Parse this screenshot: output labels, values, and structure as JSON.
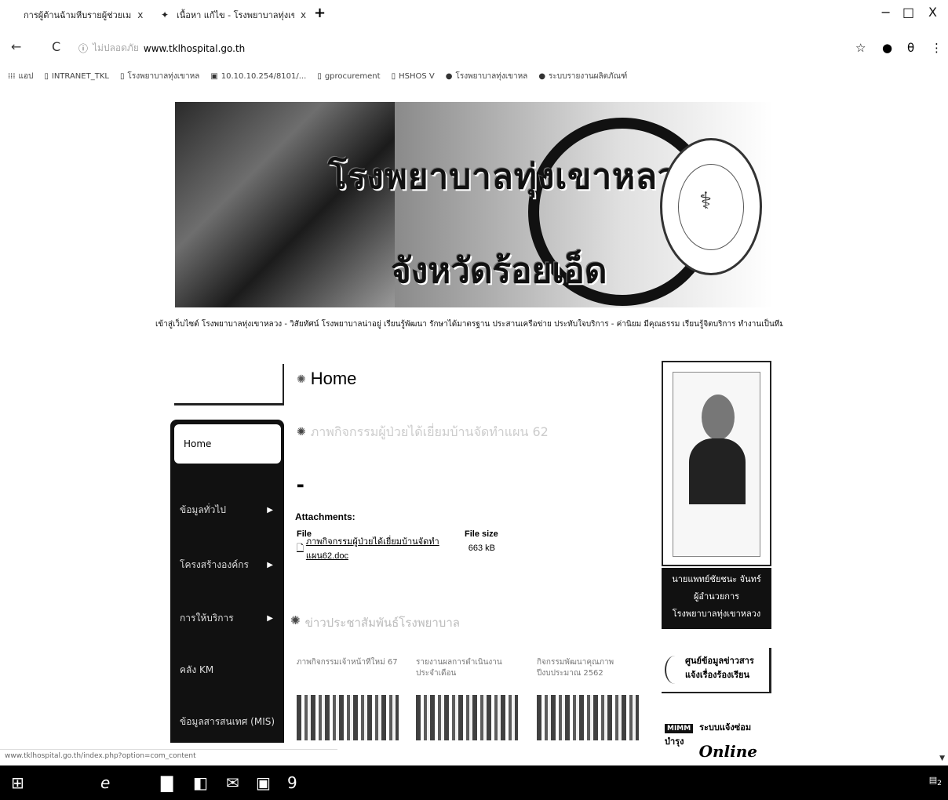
{
  "browser": {
    "tabs": [
      {
        "title": "การผู้ต้านฉ้ามหีบรายผู้ช่วยเม",
        "close": "x"
      },
      {
        "title": "เนื้อหา แก้ไข - โรงพยาบาลทุ่งเขา",
        "close": "x"
      }
    ],
    "new_tab": "+",
    "window_controls": {
      "minimize": "−",
      "maximize": "□",
      "close": "X"
    },
    "nav": {
      "back": "←",
      "reload": "C"
    },
    "url": {
      "scheme": "ไม่ปลอดภัย",
      "host": "www.tklhospital.go.th"
    },
    "bookmarks": [
      {
        "label": "แอป"
      },
      {
        "label": "INTRANET_TKL"
      },
      {
        "label": "โรงพยาบาลทุ่งเขาหล"
      },
      {
        "label": "10.10.10.254/8101/..."
      },
      {
        "label": "gprocurement"
      },
      {
        "label": "HSHOS V"
      },
      {
        "label": "โรงพยาบาลทุ่งเขาหล"
      },
      {
        "label": "ระบบรายงานผลิตภัณฑ์"
      }
    ]
  },
  "banner": {
    "title": "โรงพยาบาลทุ่งเขาหลวง",
    "subtitle": "จังหวัดร้อยเอ็ด"
  },
  "marquee": "เข้าสู่เว็บไซต์ โรงพยาบาลทุ่งเขาหลวง - วิสัยทัศน์ โรงพยาบาลน่าอยู่ เรียนรู้พัฒนา รักษาได้มาตรฐาน ประสานเครือข่าย ประทับใจบริการ - ค่านิยม มีคุณธรรม เรียนรู้จิตบริการ ทำงานเป็นทีม",
  "sidebar": {
    "items": [
      {
        "label": "Home",
        "arrow": ""
      },
      {
        "label": "ข้อมูลทั่วไป",
        "arrow": "▶"
      },
      {
        "label": "โครงสร้างองค์กร",
        "arrow": "▶"
      },
      {
        "label": "การให้บริการ",
        "arrow": "▶"
      },
      {
        "label": "คลัง KM",
        "arrow": ""
      },
      {
        "label": "ข้อมูลสารสนเทศ (MIS)",
        "arrow": ""
      }
    ]
  },
  "main": {
    "heading": "Home",
    "article_title": "ภาพกิจกรรมผู้ป่วยได้เยี่ยมบ้านจัดทำแผน 62",
    "attachments": {
      "heading": "Attachments:",
      "columns": {
        "file": "File",
        "size": "File size"
      },
      "rows": [
        {
          "file": "ภาพกิจกรรมผู้ป่วยได้เยี่ยมบ้านจัดทำแผน62.doc",
          "size": "663 kB"
        }
      ]
    },
    "news_heading": "ข่าวประชาสัมพันธ์โรงพยาบาล",
    "news": [
      {
        "caption": "ภาพกิจกรรมเจ้าหน้าที่ใหม่ 67"
      },
      {
        "caption": "รายงานผลการดำเนินงาน ประจำเดือน"
      },
      {
        "caption": "กิจกรรมพัฒนาคุณภาพ ปีงบประมาณ 2562"
      }
    ]
  },
  "right": {
    "director_caption": [
      "นายแพทย์ชัยชนะ จันทร์",
      "ผู้อำนวยการ",
      "โรงพยาบาลทุ่งเขาหลวง"
    ],
    "promo1": [
      "ศูนย์ข้อมูลข่าวสาร",
      "แจ้งเรื่องร้องเรียน"
    ],
    "promo2": {
      "badge": "MIMM",
      "text": "ระบบแจ้งซ่อมบำรุง",
      "online": "Online"
    }
  },
  "status_bar": "www.tklhospital.go.th/index.php?option=com_content",
  "taskbar": {
    "items": [
      {
        "icon": "windows-icon",
        "glyph": "⊞"
      },
      {
        "icon": "edge-icon",
        "glyph": "e"
      },
      {
        "icon": "file-explorer-icon",
        "glyph": "▇"
      },
      {
        "icon": "store-icon",
        "glyph": "◧"
      },
      {
        "icon": "mail-icon",
        "glyph": "✉"
      },
      {
        "icon": "photos-icon",
        "glyph": "▣"
      },
      {
        "icon": "app-icon",
        "glyph": "9"
      }
    ],
    "notification": "2"
  }
}
